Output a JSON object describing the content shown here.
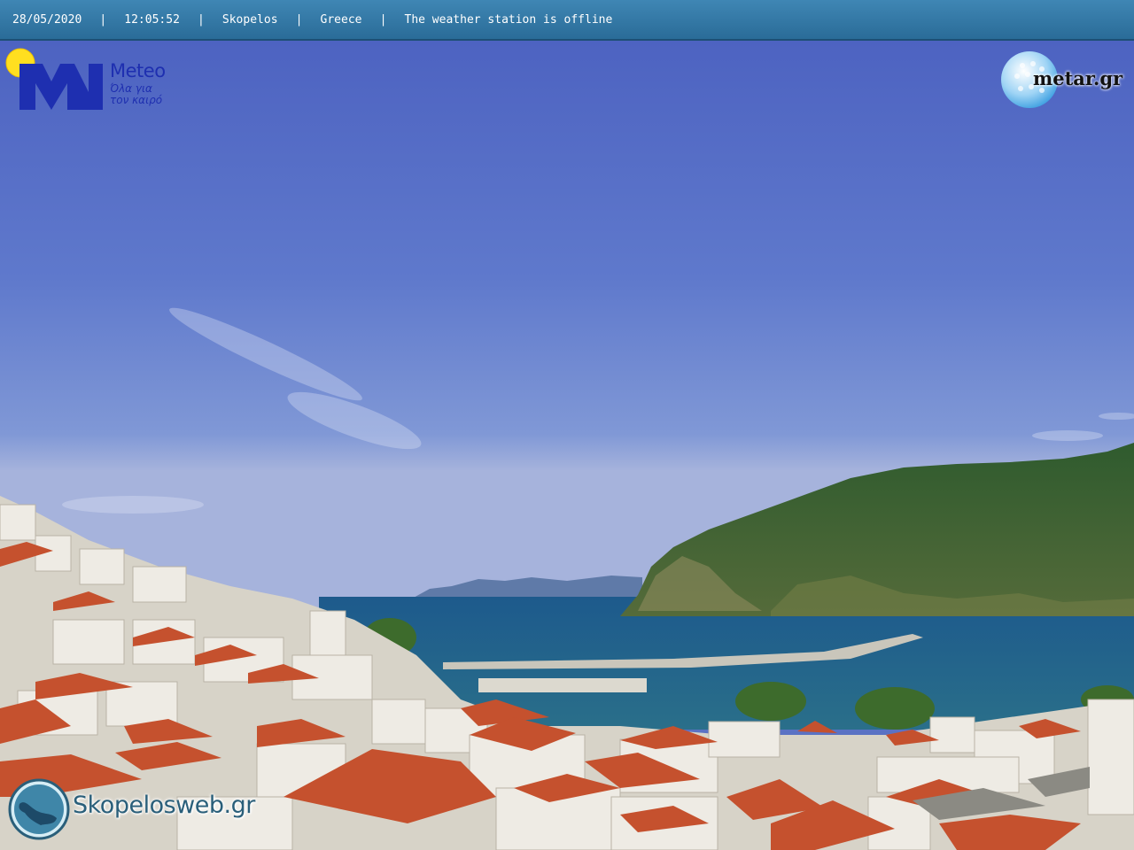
{
  "top_bar": {
    "date": "28/05/2020",
    "time": "12:05:52",
    "location": "Skopelos",
    "country": "Greece",
    "status": "The weather station is offline",
    "separator": "|"
  },
  "meteo_logo": {
    "title": "Meteo",
    "tagline": "Όλα για τον καιρό",
    "icon": "meteo-m-sun-logo"
  },
  "metar_logo": {
    "text": "metar.gr",
    "icon": "golf-ball-globe-logo"
  },
  "skopelosweb_logo": {
    "text": "Skopelosweb.gr",
    "icon": "island-map-badge"
  },
  "colors": {
    "sky_top": "#4c62c0",
    "sky_horizon": "#8fa2d8",
    "sea": "#1f5c86",
    "hill": "#3f6a36",
    "roof": "#c4512f",
    "topbar": "#3478a8"
  }
}
